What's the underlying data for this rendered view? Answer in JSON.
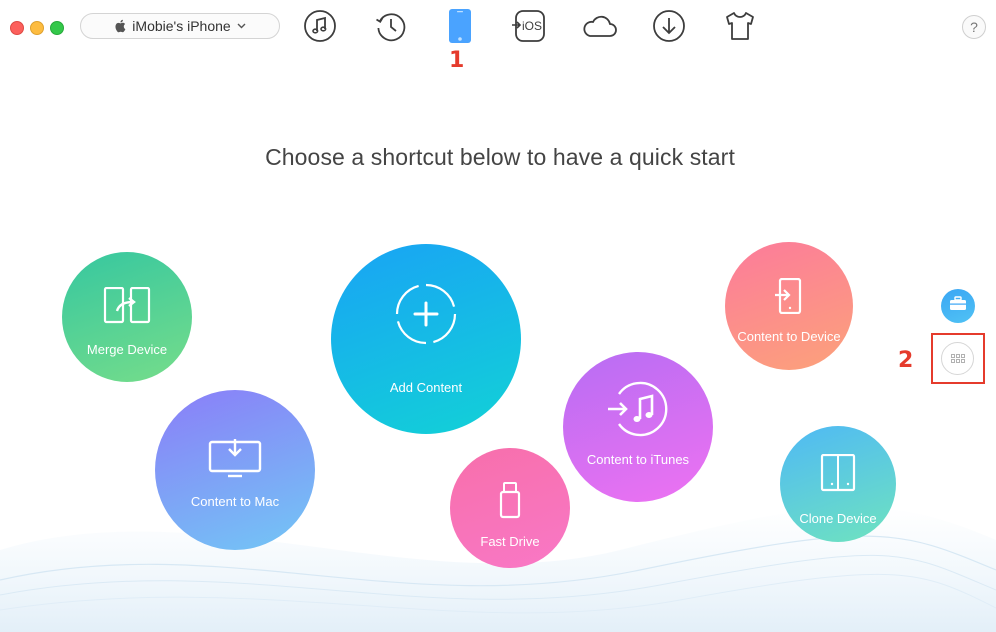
{
  "toolbar": {
    "device_name": "iMobie's iPhone",
    "icons": [
      "music-icon",
      "history-icon",
      "phone-icon",
      "to-ios-icon",
      "cloud-icon",
      "download-icon",
      "shirt-icon"
    ],
    "help_label": "?"
  },
  "annotations": {
    "step1": "1",
    "step2": "2"
  },
  "main": {
    "headline": "Choose a shortcut below to have a quick start",
    "shortcuts": [
      {
        "label": "Merge Device"
      },
      {
        "label": "Content to Mac"
      },
      {
        "label": "Add Content"
      },
      {
        "label": "Fast Drive"
      },
      {
        "label": "Content to iTunes"
      },
      {
        "label": "Content to Device"
      },
      {
        "label": "Clone Device"
      }
    ]
  },
  "colors": {
    "accent_red": "#e53b2c",
    "active_tab": "#4aa3ff"
  }
}
